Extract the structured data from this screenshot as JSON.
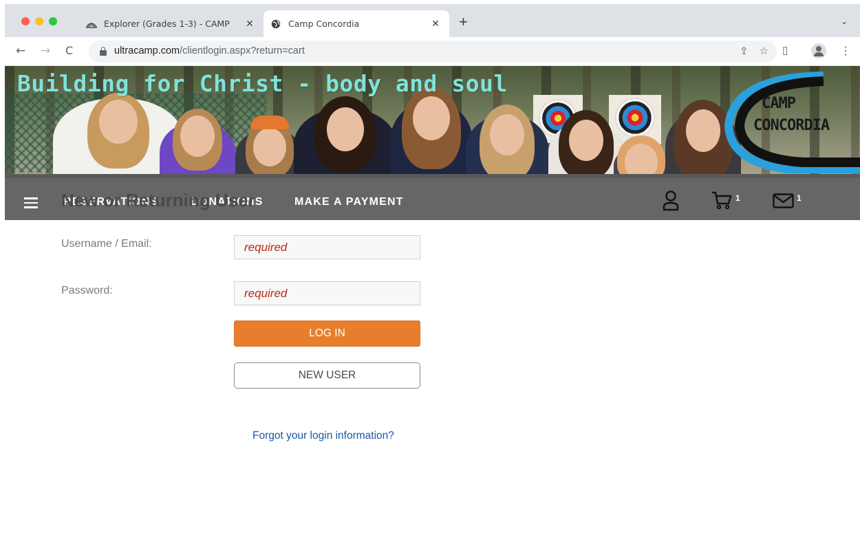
{
  "browser": {
    "tabs": [
      {
        "title": "Explorer (Grades 1-3) - CAMP",
        "active": false,
        "favicon": "ultracamp-icon"
      },
      {
        "title": "Camp Concordia",
        "active": true,
        "favicon": "globe-icon"
      }
    ],
    "url_host": "ultracamp.com",
    "url_path": "/clientlogin.aspx?return=cart"
  },
  "banner": {
    "tagline": "Building for Christ - body and soul",
    "logo_line1": "CAMP",
    "logo_line2": "CONCORDIA"
  },
  "nav": {
    "items": [
      {
        "label": "RESERVATIONS"
      },
      {
        "label": "DONATIONS"
      },
      {
        "label": "MAKE A PAYMENT"
      }
    ],
    "cart_count": "1",
    "mail_count": "1",
    "colors": {
      "bar": "#666666",
      "text": "#ffffff"
    }
  },
  "form": {
    "title": "New or Returning User",
    "username_label": "Username / Email:",
    "username_placeholder": "required",
    "username_value": "",
    "password_label": "Password:",
    "password_placeholder": "required",
    "password_value": "",
    "login_label": "LOG IN",
    "new_user_label": "NEW USER",
    "forgot_label": "Forgot your login information?",
    "colors": {
      "login_button": "#e87e2b",
      "placeholder": "#b22a18",
      "link": "#1756a6"
    }
  }
}
